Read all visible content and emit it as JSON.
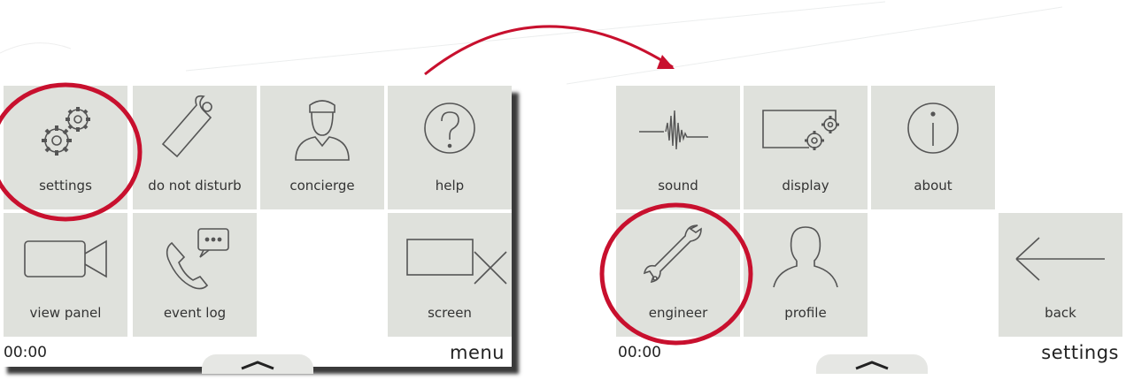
{
  "menu_screen": {
    "tiles": [
      {
        "label": "settings",
        "icon": "gears-icon"
      },
      {
        "label": "do not disturb",
        "icon": "door-hanger-icon"
      },
      {
        "label": "concierge",
        "icon": "concierge-person-icon"
      },
      {
        "label": "help",
        "icon": "question-icon"
      },
      {
        "label": "view panel",
        "icon": "camera-icon"
      },
      {
        "label": "event log",
        "icon": "phone-message-icon"
      },
      {
        "label": "screen",
        "icon": "screen-off-icon"
      }
    ],
    "time": "00:00",
    "title": "menu"
  },
  "settings_screen": {
    "tiles": [
      {
        "label": "sound",
        "icon": "waveform-icon"
      },
      {
        "label": "display",
        "icon": "display-gears-icon"
      },
      {
        "label": "about",
        "icon": "info-icon"
      },
      {
        "label": "engineer",
        "icon": "wrench-icon"
      },
      {
        "label": "profile",
        "icon": "person-silhouette-icon"
      },
      {
        "label": "back",
        "icon": "back-arrow-icon"
      }
    ],
    "time": "00:00",
    "title": "settings"
  },
  "colors": {
    "tile_bg": "#dfe1dc",
    "highlight_red": "#c8102e",
    "icon_stroke": "#555555"
  }
}
